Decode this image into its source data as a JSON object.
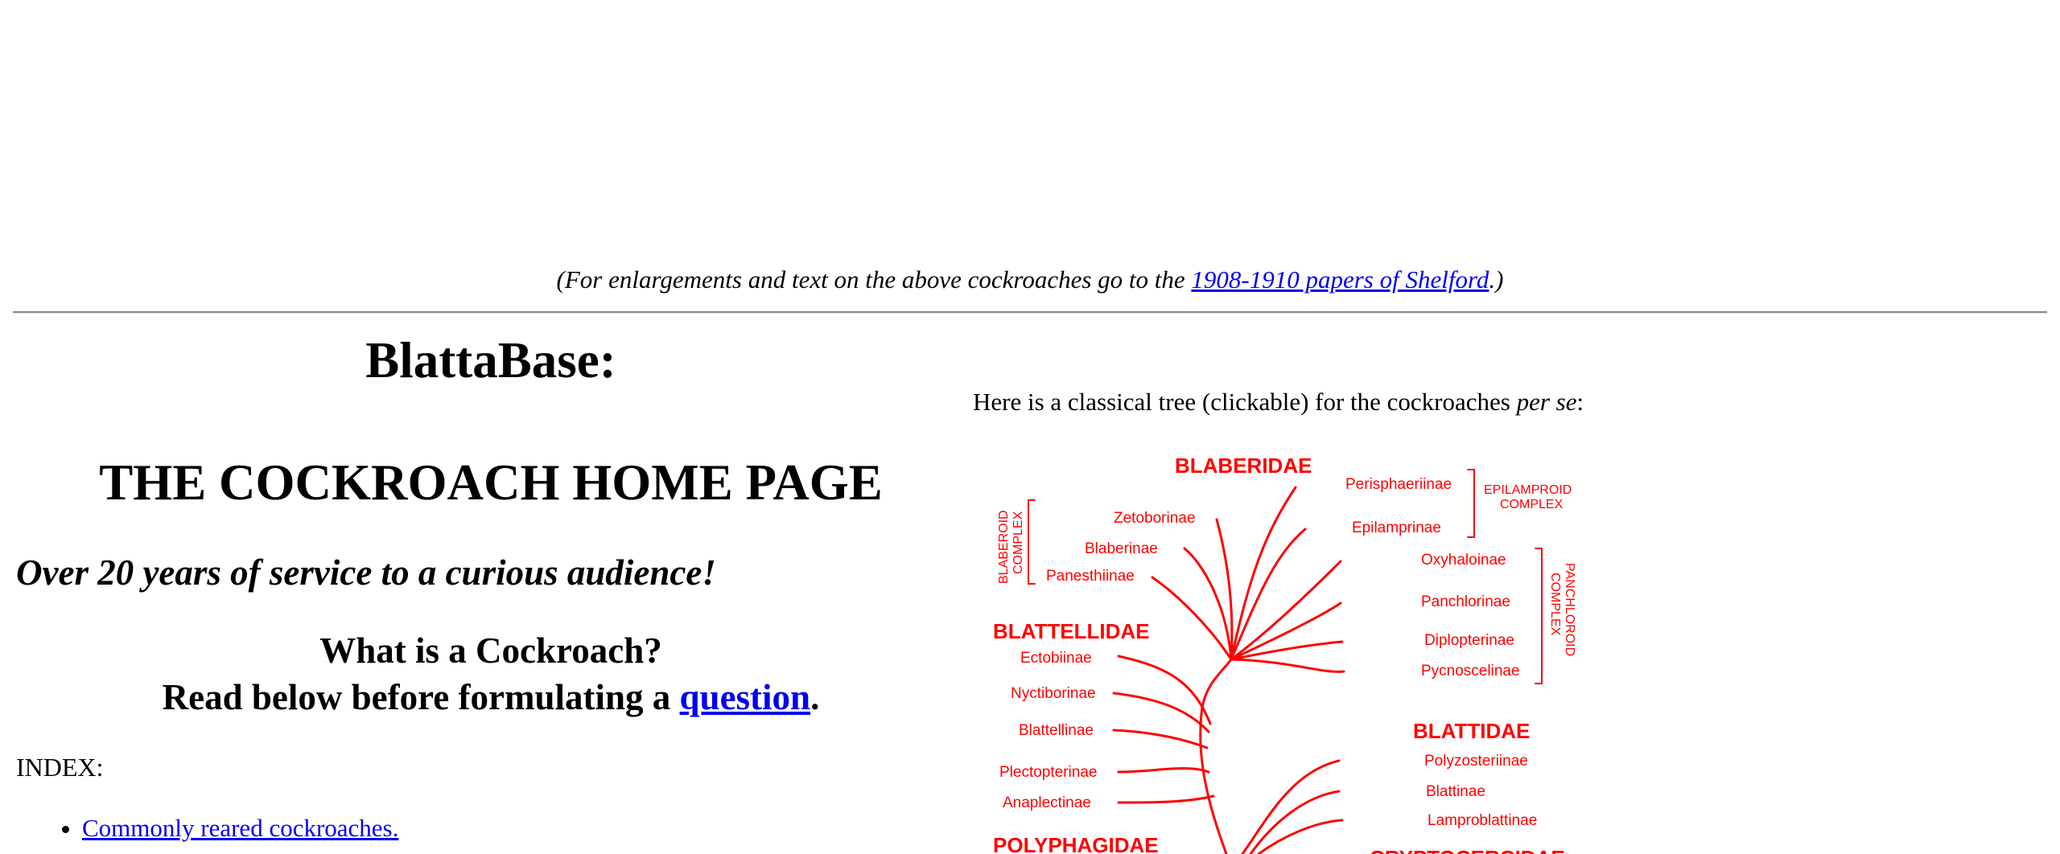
{
  "caption": {
    "before": "(For enlargements and text on the above cockroaches go to the ",
    "link": "1908-1910 papers of Shelford",
    "after": ".)"
  },
  "headings": {
    "blattabase": "BlattaBase:",
    "home": "THE COCKROACH HOME PAGE",
    "tagline": "Over 20 years of service to a curious audience!",
    "what_line1": "What is a Cockroach?",
    "what_line2_before": "Read below before formulating a ",
    "what_line2_link": "question",
    "what_line2_after": "."
  },
  "index": {
    "label": "INDEX:",
    "items": [
      "Commonly reared cockroaches."
    ]
  },
  "tree": {
    "intro_before": "Here is a classical tree (clickable) for the cockroaches ",
    "intro_italic": "per se",
    "intro_after": ":",
    "color": "#ff0000",
    "families": [
      "BLABERIDAE",
      "BLATTELLIDAE",
      "BLATTIDAE",
      "POLYPHAGIDAE",
      "CRYPTOCERCIDAE"
    ],
    "subfamilies": [
      "Perisphaeriinae",
      "Epilamprinae",
      "Zetoborinae",
      "Blaberinae",
      "Panesthiinae",
      "Oxyhaloinae",
      "Panchlorinae",
      "Diplopterinae",
      "Pycnoscelinae",
      "Ectobiinae",
      "Nyctiborinae",
      "Blattellinae",
      "Plectopterinae",
      "Anaplectinae",
      "Polyzosteriinae",
      "Blattinae",
      "Lamproblattinae"
    ],
    "complexes": {
      "epilamproid": [
        "EPILAMPROID",
        "COMPLEX"
      ],
      "blaberoid": [
        "BLABEROID",
        "COMPLEX"
      ],
      "panchloroid": [
        "PANCHLOROID",
        "COMPLEX"
      ]
    }
  }
}
